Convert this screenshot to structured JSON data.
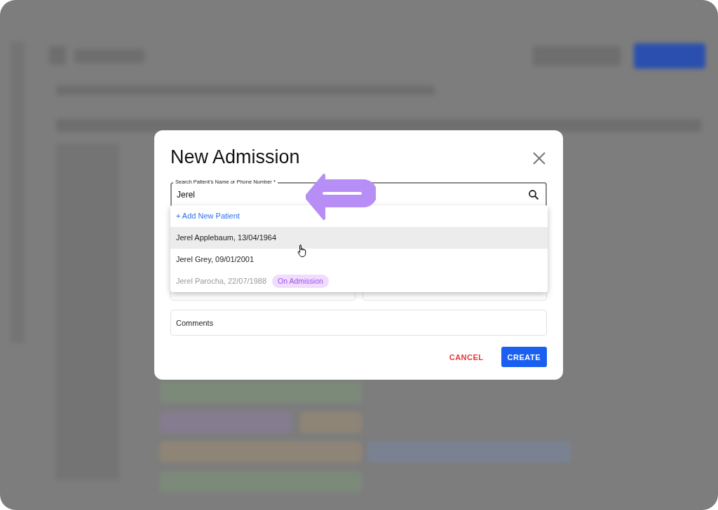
{
  "dialog": {
    "title": "New Admission",
    "search": {
      "label": "Search Patient’s Name or Phone Number *",
      "value": "Jerel"
    },
    "suggestions": [
      {
        "kind": "action",
        "text": "+ Add New Patient",
        "highlighted": false,
        "disabled": false
      },
      {
        "kind": "patient",
        "text": "Jerel Applebaum, 13/04/1964",
        "highlighted": true,
        "disabled": false
      },
      {
        "kind": "patient",
        "text": "Jerel Grey, 09/01/2001",
        "highlighted": false,
        "disabled": false
      },
      {
        "kind": "patient",
        "text": "Jerel Parocha, 22/07/1988",
        "highlighted": false,
        "disabled": true,
        "badge": "On Admission"
      }
    ],
    "comments": {
      "placeholder": "Comments"
    },
    "buttons": [
      {
        "kind": "text",
        "label": "CANCEL"
      },
      {
        "kind": "primary",
        "label": "CREATE"
      }
    ]
  }
}
